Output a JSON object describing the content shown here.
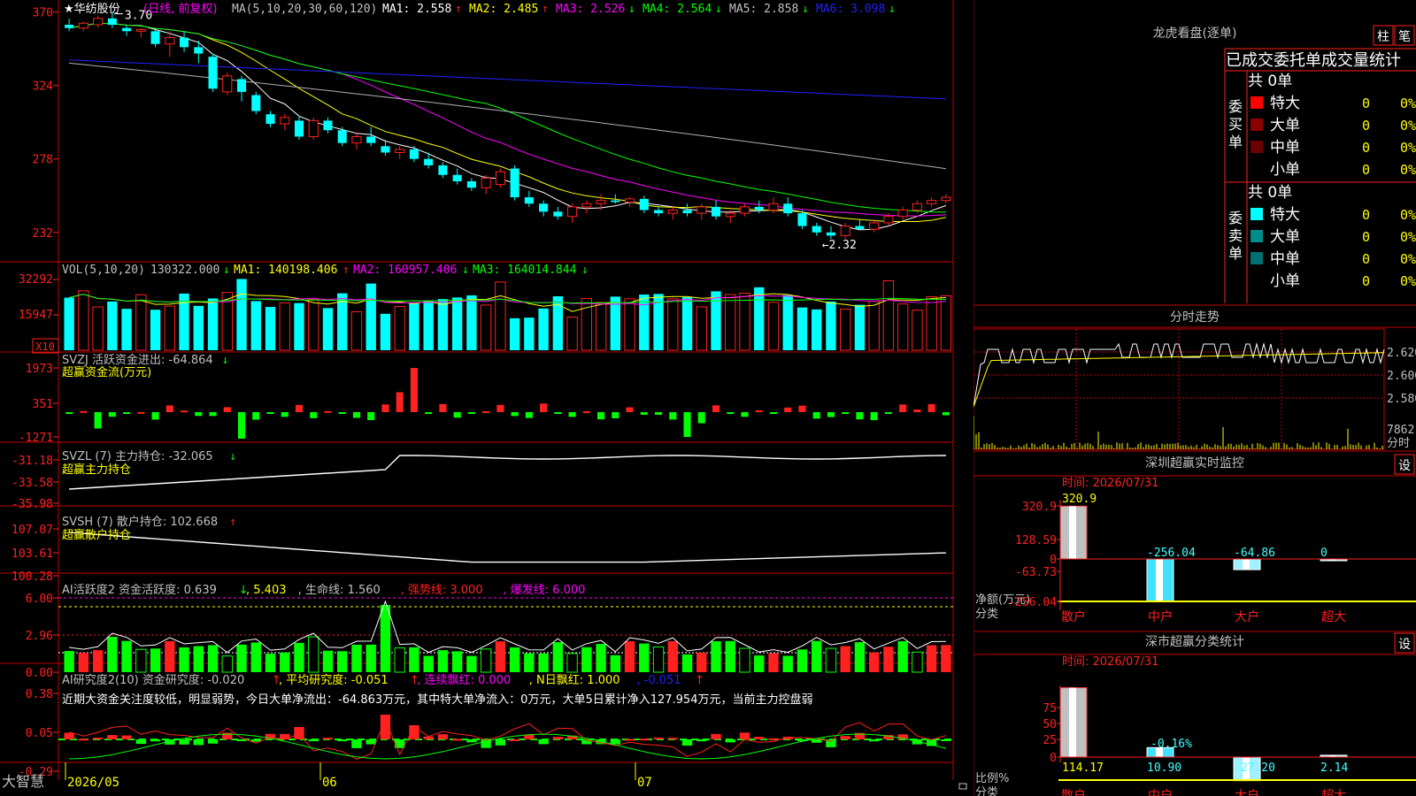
{
  "colors": {
    "up": "#ff2020",
    "down": "#00ffff",
    "frame": "#c00000",
    "text": "#c0c0c0",
    "yellow": "#ffff00",
    "magenta": "#ff00ff",
    "green": "#00ff00",
    "blue": "#2020ff",
    "grey": "#b0b0b0",
    "white": "#ffffff",
    "brand_fg": "#ffffff"
  },
  "header": {
    "star": "★",
    "stock_name": "华纺股份",
    "period_label": "(日线, 前复权)",
    "ma_title": "MA(5,10,20,30,60,120)",
    "ma_items": [
      {
        "label": "MA1: 2.558",
        "arrow": "↑",
        "color": "#ffffff",
        "arrow_color": "#ff2020"
      },
      {
        "label": "MA2: 2.485",
        "arrow": "↑",
        "color": "#ffff00",
        "arrow_color": "#ff2020"
      },
      {
        "label": "MA3: 2.526",
        "arrow": "↓",
        "color": "#ff00ff",
        "arrow_color": "#00ff00"
      },
      {
        "label": "MA4: 2.564",
        "arrow": "↓",
        "color": "#00ff00",
        "arrow_color": "#00ff00"
      },
      {
        "label": "MA5: 2.858",
        "arrow": "↓",
        "color": "#c0c0c0",
        "arrow_color": "#00ff00"
      },
      {
        "label": "MA6: 3.098",
        "arrow": "↓",
        "color": "#2020ff",
        "arrow_color": "#00ff00"
      }
    ],
    "high_marker": "3.70",
    "low_marker": "←2.32"
  },
  "price_axis": [
    "370",
    "324",
    "278",
    "232"
  ],
  "volume": {
    "title": "VOL(5,10,20)",
    "items": [
      {
        "label": "130322.000",
        "arrow": "↓",
        "color": "#c0c0c0",
        "arrow_color": "#00ff00"
      },
      {
        "label": "MA1: 140198.406",
        "arrow": "↑",
        "color": "#ffff00",
        "arrow_color": "#ff2020"
      },
      {
        "label": "MA2: 160957.406",
        "arrow": "↓",
        "color": "#ff00ff",
        "arrow_color": "#00ff00"
      },
      {
        "label": "MA3: 164014.844",
        "arrow": "↓",
        "color": "#00ff00",
        "arrow_color": "#00ff00"
      }
    ],
    "axis": [
      "32292",
      "15947"
    ],
    "unit_badge": "X10"
  },
  "svzj": {
    "title": "SVZJ",
    "label": "活跃资金进出: -64.864",
    "arrow": "↓",
    "subtitle": "超赢资金流(万元)",
    "axis": [
      "1973",
      "351",
      "-1271"
    ]
  },
  "svzl": {
    "title": "SVZL (7)",
    "label": "主力持仓: -32.065",
    "arrow": "↓",
    "subtitle": "超赢主力持仓",
    "axis": [
      "-31.18",
      "-33.58",
      "-35.98"
    ]
  },
  "svsh": {
    "title": "SVSH (7)",
    "label": "散户持仓: 102.668",
    "arrow": "↑",
    "subtitle": "超赢散户持仓",
    "axis": [
      "107.07",
      "103.61",
      "100.28"
    ]
  },
  "ai_active": {
    "title": "AI活跃度2",
    "label": "资金活跃度: 0.639",
    "arrow": "↓",
    "v2": "5.403",
    "life": "生命线: 1.560",
    "strong": "强势线: 3.000",
    "burst": "爆发线: 6.000",
    "axis": [
      "6.00",
      "2.96",
      "0.00"
    ]
  },
  "ai_research": {
    "title": "AI研究度2(10)",
    "label": "资金研究度: -0.020",
    "arrow": "↑",
    "avg": "平均研究度: -0.051",
    "avg_arrow": "↑",
    "red": "连续飘红: 0.000",
    "nred": "N日飘红: 1.000",
    "last": "-0.051",
    "last_arrow": "↑",
    "desc": "近期大资金关注度较低，明显弱势，今日大单净流出：-64.863万元，其中特大单净流入：0万元，大单5日累计净入127.954万元，当前主力控盘弱",
    "axis": [
      "0.38",
      "0.05",
      "-0.29"
    ]
  },
  "bottom": {
    "brand": "大智慧",
    "dates": [
      "2026/05",
      "06",
      "07"
    ]
  },
  "dragon": {
    "title": "龙虎看盘(逐单)",
    "btn1": "柱",
    "btn2": "笔",
    "tabs": "已成交委托单成交量统计",
    "buy": {
      "side": "委买单",
      "total": "共 0单",
      "rows": [
        {
          "name": "特大",
          "v": "0",
          "p": "0%",
          "color": "#ff0000"
        },
        {
          "name": "大单",
          "v": "0",
          "p": "0%",
          "color": "#8b0000"
        },
        {
          "name": "中单",
          "v": "0",
          "p": "0%",
          "color": "#6b0000"
        },
        {
          "name": "小单",
          "v": "0",
          "p": "0%",
          "color": "#000000"
        }
      ]
    },
    "sell": {
      "side": "委卖单",
      "total": "共 0单",
      "rows": [
        {
          "name": "特大",
          "v": "0",
          "p": "0%",
          "color": "#00ffff"
        },
        {
          "name": "大单",
          "v": "0",
          "p": "0%",
          "color": "#008b8b"
        },
        {
          "name": "中单",
          "v": "0",
          "p": "0%",
          "color": "#007070"
        },
        {
          "name": "小单",
          "v": "0",
          "p": "0%",
          "color": "#000000"
        }
      ]
    }
  },
  "timeshare": {
    "title": "分时走势",
    "axis": [
      "2.620",
      "2.600",
      "2.580"
    ],
    "vol": "7862",
    "vol_label": "分时"
  },
  "sz_monitor": {
    "title": "深圳超赢实时监控",
    "set": "设",
    "time": "时间: 2026/07/31",
    "axis": [
      "320.9",
      "128.59",
      "0",
      "-63.73",
      "-256.04"
    ],
    "bars": [
      {
        "name": "散户",
        "value": 320.9,
        "label": "320.9"
      },
      {
        "name": "中户",
        "value": -256.04,
        "label": "-256.04"
      },
      {
        "name": "大户",
        "value": -64.86,
        "label": "-64.86"
      },
      {
        "name": "超大",
        "value": 0,
        "label": "0"
      }
    ],
    "ylabel": "净额(万元)",
    "xlabel": "分类"
  },
  "sz_class": {
    "title": "深市超赢分类统计",
    "set": "设",
    "time": "时间: 2026/07/31",
    "axis": [
      "75",
      "50",
      "25",
      "0"
    ],
    "bars": [
      {
        "name": "散户",
        "value": 114.17,
        "label": "114.17"
      },
      {
        "name": "中户",
        "value": 10.9,
        "label": "10.90"
      },
      {
        "name": "大户",
        "value": -27.2,
        "label": "-27.20"
      },
      {
        "name": "超大",
        "value": 2.14,
        "label": "2.14"
      }
    ],
    "mid_label": "-0.16%",
    "ylabel": "比例%",
    "xlabel": "分类"
  },
  "chart_data": {
    "type": "candlestick",
    "candles": [
      [
        3.62,
        3.66,
        3.58,
        3.6
      ],
      [
        3.6,
        3.64,
        3.58,
        3.63
      ],
      [
        3.62,
        3.68,
        3.6,
        3.66
      ],
      [
        3.66,
        3.7,
        3.6,
        3.62
      ],
      [
        3.6,
        3.62,
        3.55,
        3.58
      ],
      [
        3.58,
        3.6,
        3.54,
        3.59
      ],
      [
        3.58,
        3.6,
        3.48,
        3.5
      ],
      [
        3.5,
        3.58,
        3.42,
        3.54
      ],
      [
        3.54,
        3.58,
        3.45,
        3.48
      ],
      [
        3.48,
        3.52,
        3.38,
        3.44
      ],
      [
        3.42,
        3.44,
        3.2,
        3.22
      ],
      [
        3.2,
        3.32,
        3.18,
        3.3
      ],
      [
        3.28,
        3.3,
        3.14,
        3.2
      ],
      [
        3.18,
        3.2,
        3.06,
        3.08
      ],
      [
        3.06,
        3.08,
        2.98,
        3.0
      ],
      [
        3.0,
        3.06,
        2.96,
        3.04
      ],
      [
        3.02,
        3.05,
        2.9,
        2.92
      ],
      [
        2.92,
        3.04,
        2.9,
        3.02
      ],
      [
        3.02,
        3.04,
        2.94,
        2.96
      ],
      [
        2.96,
        2.98,
        2.86,
        2.88
      ],
      [
        2.88,
        2.94,
        2.84,
        2.92
      ],
      [
        2.92,
        2.98,
        2.86,
        2.88
      ],
      [
        2.86,
        2.9,
        2.8,
        2.82
      ],
      [
        2.82,
        2.86,
        2.78,
        2.84
      ],
      [
        2.84,
        2.86,
        2.76,
        2.78
      ],
      [
        2.78,
        2.82,
        2.72,
        2.74
      ],
      [
        2.74,
        2.76,
        2.66,
        2.68
      ],
      [
        2.68,
        2.72,
        2.62,
        2.64
      ],
      [
        2.64,
        2.66,
        2.58,
        2.6
      ],
      [
        2.6,
        2.68,
        2.56,
        2.66
      ],
      [
        2.62,
        2.72,
        2.6,
        2.7
      ],
      [
        2.72,
        2.74,
        2.52,
        2.54
      ],
      [
        2.54,
        2.58,
        2.48,
        2.5
      ],
      [
        2.5,
        2.52,
        2.42,
        2.45
      ],
      [
        2.45,
        2.48,
        2.4,
        2.42
      ],
      [
        2.42,
        2.5,
        2.38,
        2.48
      ],
      [
        2.48,
        2.52,
        2.44,
        2.5
      ],
      [
        2.5,
        2.56,
        2.46,
        2.52
      ],
      [
        2.52,
        2.56,
        2.5,
        2.51
      ],
      [
        2.51,
        2.54,
        2.48,
        2.53
      ],
      [
        2.53,
        2.55,
        2.44,
        2.46
      ],
      [
        2.46,
        2.48,
        2.42,
        2.44
      ],
      [
        2.44,
        2.48,
        2.4,
        2.46
      ],
      [
        2.46,
        2.5,
        2.42,
        2.44
      ],
      [
        2.44,
        2.5,
        2.4,
        2.48
      ],
      [
        2.48,
        2.52,
        2.4,
        2.42
      ],
      [
        2.42,
        2.46,
        2.38,
        2.44
      ],
      [
        2.44,
        2.5,
        2.42,
        2.48
      ],
      [
        2.48,
        2.52,
        2.44,
        2.46
      ],
      [
        2.46,
        2.54,
        2.44,
        2.5
      ],
      [
        2.5,
        2.54,
        2.42,
        2.44
      ],
      [
        2.44,
        2.46,
        2.34,
        2.36
      ],
      [
        2.36,
        2.38,
        2.3,
        2.32
      ],
      [
        2.32,
        2.36,
        2.28,
        2.3
      ],
      [
        2.3,
        2.38,
        2.28,
        2.36
      ],
      [
        2.36,
        2.4,
        2.34,
        2.34
      ],
      [
        2.34,
        2.4,
        2.32,
        2.38
      ],
      [
        2.38,
        2.44,
        2.36,
        2.42
      ],
      [
        2.42,
        2.48,
        2.4,
        2.46
      ],
      [
        2.46,
        2.52,
        2.44,
        2.5
      ],
      [
        2.5,
        2.54,
        2.48,
        2.52
      ],
      [
        2.52,
        2.56,
        2.5,
        2.54
      ]
    ]
  }
}
